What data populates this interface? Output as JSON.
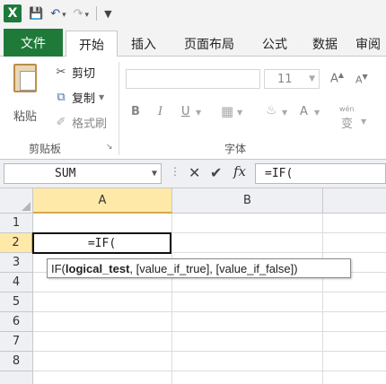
{
  "quick_access": {
    "app_icon": "X",
    "icons": [
      "excel-logo-icon",
      "save-icon",
      "undo-icon",
      "redo-icon",
      "customize-toolbar-icon"
    ]
  },
  "tabs": [
    {
      "label": "文件"
    },
    {
      "label": "开始"
    },
    {
      "label": "插入"
    },
    {
      "label": "页面布局"
    },
    {
      "label": "公式"
    },
    {
      "label": "数据"
    },
    {
      "label": "审阅"
    }
  ],
  "ribbon": {
    "clipboard": {
      "paste_label": "粘贴",
      "cut_label": "剪切",
      "copy_label": "复制",
      "format_painter_label": "格式刷",
      "group_label": "剪贴板"
    },
    "font": {
      "font_name": "",
      "font_size": "11",
      "group_label": "字体",
      "bold": "B",
      "italic": "I",
      "underline": "U",
      "grow": "A",
      "shrink": "A",
      "font_color": "A",
      "phonetic_top": "wén",
      "phonetic": "变"
    }
  },
  "formula_bar": {
    "name_box": "SUM",
    "content": "=IF(",
    "fx": "fx"
  },
  "grid": {
    "columns": [
      "A",
      "B"
    ],
    "rows": [
      "1",
      "2",
      "3",
      "4",
      "5",
      "6",
      "7",
      "8"
    ],
    "active_cell": {
      "ref": "A2",
      "value": "=IF("
    },
    "tooltip": {
      "prefix": "IF(",
      "current_arg": "logical_test",
      "rest": ", [value_if_true], [value_if_false])"
    }
  },
  "colors": {
    "file_tab": "#1f7a3a",
    "active_header": "#ffe9a8",
    "header_bg": "#eef0f3"
  }
}
